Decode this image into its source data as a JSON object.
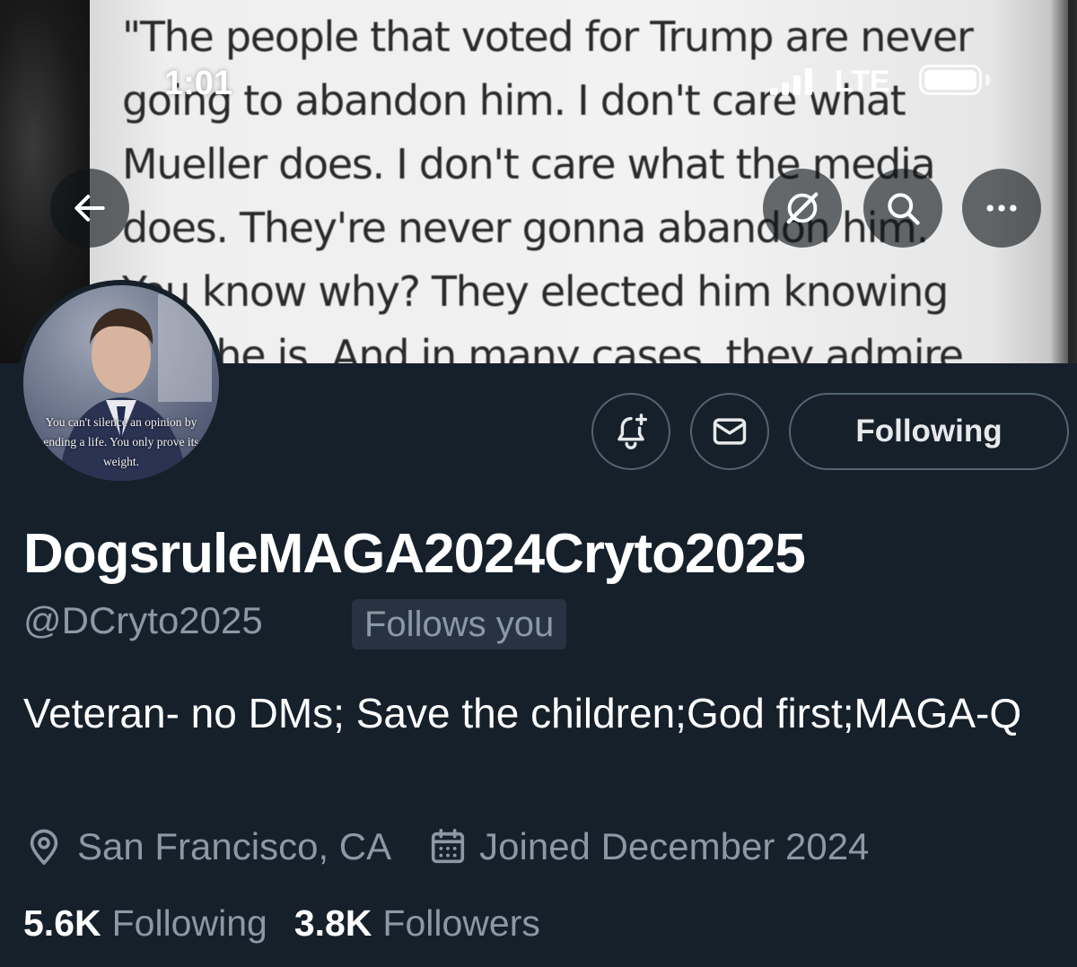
{
  "banner": {
    "quote_text": "\"The people that voted for Trump are never\ngoing to abandon him.  I don't care what\nMueller does.  I don't care what the media\ndoes.  They're never gonna abandon him.\nYou know why?  They elected him knowing\nwho he is.  And in many cases, they admire"
  },
  "status_bar": {
    "time": "1:01",
    "network": "LTE"
  },
  "avatar": {
    "caption": "You can't silence an opinion by ending a life. You only prove its weight."
  },
  "actions": {
    "following_label": "Following"
  },
  "profile": {
    "display_name": "DogsruleMAGA2024Cryto2025",
    "handle": "@DCryto2025",
    "follows_you": "Follows you",
    "bio": "Veteran- no DMs; Save the children;God first;MAGA-Q",
    "location": "San Francisco, CA",
    "joined": "Joined December 2024",
    "following_count": "5.6K",
    "following_label": "Following",
    "followers_count": "3.8K",
    "followers_label": "Followers"
  },
  "icons": {
    "back": "arrow-left-icon",
    "grok": "grok-icon",
    "search": "search-icon",
    "more": "more-icon",
    "notify": "bell-plus-icon",
    "message": "envelope-icon",
    "location": "map-pin-icon",
    "calendar": "calendar-icon"
  },
  "colors": {
    "background": "#15202b",
    "secondary_text": "#8b98a5",
    "button_border": "#536471"
  }
}
